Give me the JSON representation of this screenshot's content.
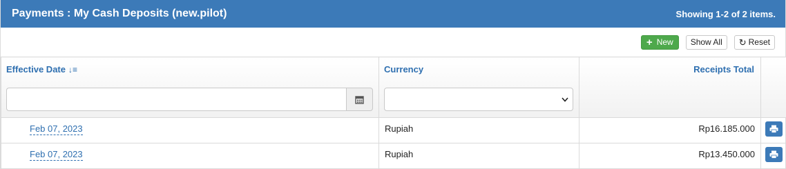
{
  "header": {
    "title": "Payments : My Cash Deposits (new.pilot)",
    "summary": "Showing 1-2 of 2 items."
  },
  "toolbar": {
    "new_label": "New",
    "show_all_label": "Show All",
    "reset_label": "Reset"
  },
  "table": {
    "columns": {
      "effective_date": "Effective Date",
      "currency": "Currency",
      "receipts_total": "Receipts Total"
    },
    "filters": {
      "effective_date_value": "",
      "currency_selected": ""
    },
    "rows": [
      {
        "effective_date": "Feb 07, 2023",
        "currency": "Rupiah",
        "receipts_total": "Rp16.185.000"
      },
      {
        "effective_date": "Feb 07, 2023",
        "currency": "Rupiah",
        "receipts_total": "Rp13.450.000"
      }
    ]
  },
  "icons": {
    "new": "plus-icon",
    "reset": "refresh-icon",
    "sort": "sort-descending-icon",
    "calendar": "calendar-icon",
    "dropdown": "chevron-down-icon",
    "print": "print-icon"
  },
  "colors": {
    "header_bg": "#3c7ab8",
    "link": "#2e6fb0",
    "new_button": "#4ea94c",
    "print_button": "#3c7ab8"
  }
}
